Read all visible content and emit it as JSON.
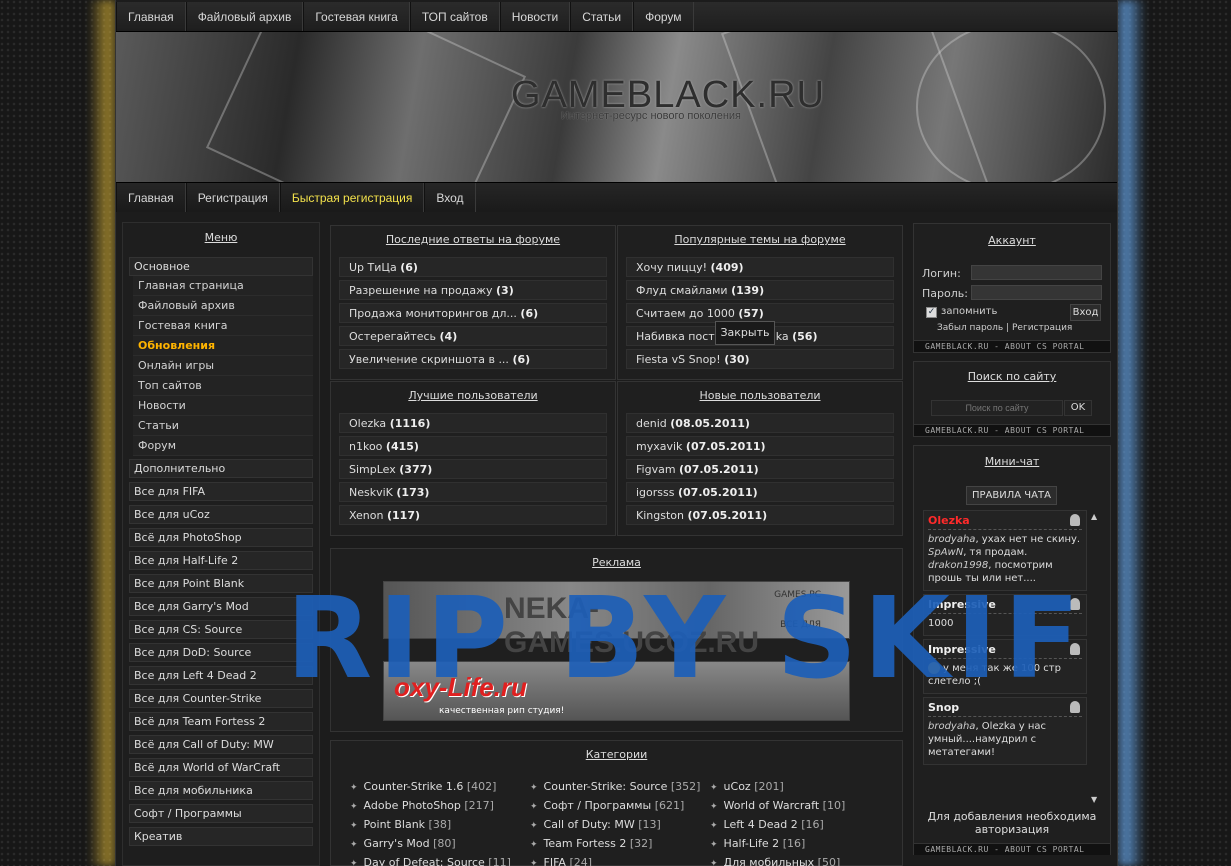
{
  "top_nav": [
    "Главная",
    "Файловый архив",
    "Гостевая книга",
    "ТОП сайтов",
    "Новости",
    "Статьи",
    "Форум"
  ],
  "banner": {
    "title": "GAMEBLACK.RU",
    "subtitle": "Интернет-ресурс нового поколения"
  },
  "sub_nav": [
    {
      "label": "Главная"
    },
    {
      "label": "Регистрация"
    },
    {
      "label": "Быстрая регистрация"
    },
    {
      "label": "Вход"
    }
  ],
  "menu": {
    "title": "Меню",
    "section": "Основное",
    "sub": [
      "Главная страница",
      "Файловый архив",
      "Гостевая книга",
      "Обновления",
      "Онлайн игры",
      "Топ сайтов",
      "Новости",
      "Статьи",
      "Форум"
    ],
    "items": [
      "Дополнительно",
      "Все для FIFA",
      "Все для uCoz",
      "Всё для PhotoShop",
      "Все для Half-Life 2",
      "Все для Point Blank",
      "Все для Garry's Mod",
      "Все для CS: Source",
      "Все для DoD: Source",
      "Все для Left 4 Dead 2",
      "Все для Counter-Strike",
      "Всё для Team Fortess 2",
      "Всё для Call of Duty: MW",
      "Всё для World of WarCraft",
      "Все для мобильника",
      "Софт / Программы",
      "Креатив"
    ]
  },
  "forum_replies": {
    "title": "Последние ответы на форуме",
    "rows": [
      {
        "t": "Up ТиЦа",
        "n": "(6)"
      },
      {
        "t": "Разрешение на продажу",
        "n": "(3)"
      },
      {
        "t": "Продажа мониторингов дл...",
        "n": "(6)"
      },
      {
        "t": "Остерегайтесь",
        "n": "(4)"
      },
      {
        "t": "Увеличение скриншота в ...",
        "n": "(6)"
      }
    ]
  },
  "popular_topics": {
    "title": "Популярные темы на форуме",
    "rows": [
      {
        "t": "Хочу пиццу!",
        "n": "(409)"
      },
      {
        "t": "Флуд смайлами",
        "n": "(139)"
      },
      {
        "t": "Считаем до 1000",
        "n": "(57)"
      },
      {
        "t": "Набивка пост",
        "n": "(56)"
      },
      {
        "t": "Fiesta vS Snop!",
        "n": "(30)"
      }
    ],
    "row4_suffix": "ka"
  },
  "best_users": {
    "title": "Лучшие пользователи",
    "rows": [
      {
        "t": "Olezka",
        "n": "(1116)"
      },
      {
        "t": "n1koo",
        "n": "(415)"
      },
      {
        "t": "SimpLex",
        "n": "(377)"
      },
      {
        "t": "NeskviK",
        "n": "(173)"
      },
      {
        "t": "Xenon",
        "n": "(117)"
      }
    ]
  },
  "new_users": {
    "title": "Новые пользователи",
    "rows": [
      {
        "t": "denid",
        "n": "(08.05.2011)"
      },
      {
        "t": "myxavik",
        "n": "(07.05.2011)"
      },
      {
        "t": "Figvam",
        "n": "(07.05.2011)"
      },
      {
        "t": "igorsss",
        "n": "(07.05.2011)"
      },
      {
        "t": "Kingston",
        "n": "(07.05.2011)"
      }
    ]
  },
  "tooltip": "Закрыть",
  "ads": {
    "title": "Реклама",
    "banner1": "NEKA-GAMES.UCOZ.RU",
    "banner1_side": "GAMES PC",
    "banner1_side2": "BCE ДЛЯ",
    "banner2": "oxy-Life.ru",
    "banner2_sub": "качественная рип студия!"
  },
  "categories": {
    "title": "Категории",
    "cols": [
      [
        [
          "Counter-Strike 1.6",
          "[402]"
        ],
        [
          "Adobe PhotoShop",
          "[217]"
        ],
        [
          "Point Blank",
          "[38]"
        ],
        [
          "Garry's Mod",
          "[80]"
        ],
        [
          "Day of Defeat: Source",
          "[11]"
        ]
      ],
      [
        [
          "Counter-Strike: Source",
          "[352]"
        ],
        [
          "Софт / Программы",
          "[621]"
        ],
        [
          "Call of Duty: MW",
          "[13]"
        ],
        [
          "Team Fortess 2",
          "[32]"
        ],
        [
          "FIFA",
          "[24]"
        ]
      ],
      [
        [
          "uCoz",
          "[201]"
        ],
        [
          "World of Warcraft",
          "[10]"
        ],
        [
          "Left 4 Dead 2",
          "[16]"
        ],
        [
          "Half-Life 2",
          "[16]"
        ],
        [
          "Для мобильных",
          "[50]"
        ]
      ]
    ]
  },
  "account": {
    "title": "Аккаунт",
    "login_label": "Логин:",
    "password_label": "Пароль:",
    "remember": "запомнить",
    "enter": "Вход",
    "forgot": "Забыл пароль",
    "register": "Регистрация"
  },
  "footer_stamp": "GAMEBLACK.RU - ABOUT CS PORTAL",
  "search": {
    "title": "Поиск по сайту",
    "placeholder": "Поиск по сайту",
    "ok": "OK"
  },
  "minichat": {
    "title": "Мини-чат",
    "rules": "ПРАВИЛА ЧАТА",
    "messages": [
      {
        "name": "Olezka",
        "name_color": "#ff2a2a",
        "lines": [
          {
            "i": "brodyaha",
            "t": ", ухах нет не скину."
          },
          {
            "i": "SpAwN",
            "t": ", тя продам."
          },
          {
            "i": "drakon1998",
            "t": ", посмотрим прошь ты или нет...."
          }
        ]
      },
      {
        "name": "Impressive",
        "lines": [
          {
            "t": "1000"
          }
        ]
      },
      {
        "name": "Impressive",
        "lines": [
          {
            "t": "у меня так же 100 стр слетело ;("
          }
        ]
      },
      {
        "name": "Snop",
        "lines": [
          {
            "i": "brodyaha",
            "t": ", Olezka у нас умный....намудрил с метатегами!"
          }
        ]
      }
    ],
    "notice": "Для добавления необходима авторизация"
  },
  "watermark": "RIP BY SKIF"
}
